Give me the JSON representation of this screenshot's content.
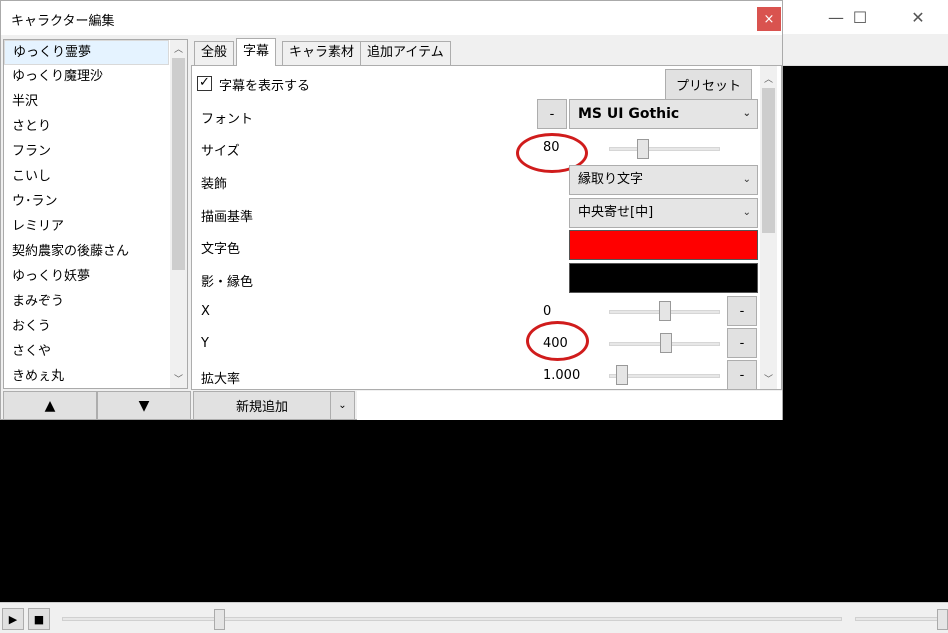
{
  "main_window": {
    "minimize_icon": "—",
    "maximize_icon": "☐",
    "close_icon": "✕"
  },
  "dialog": {
    "title": "キャラクター編集",
    "close_icon": "×"
  },
  "character_list": {
    "selected_index": 0,
    "items": [
      "ゆっくり霊夢",
      "ゆっくり魔理沙",
      "半沢",
      "さとり",
      "フラン",
      "こいし",
      "ウ･ラン",
      "レミリア",
      "契約農家の後藤さん",
      "ゆっくり妖夢",
      "まみぞう",
      "おくう",
      "さくや",
      "きめぇ丸"
    ],
    "up_button": "▲",
    "down_button": "▼"
  },
  "tabs": [
    {
      "label": "全般",
      "active": false
    },
    {
      "label": "字幕",
      "active": true
    },
    {
      "label": "キャラ素材",
      "active": false
    },
    {
      "label": "追加アイテム",
      "active": false
    }
  ],
  "subtitle_panel": {
    "show_subtitle_label": "字幕を表示する",
    "show_subtitle_checked": true,
    "checkmark": "✓",
    "preset_button": "プリセット",
    "font_label": "フォント",
    "font_minus": "-",
    "font_value": "MS UI Gothic",
    "size_label": "サイズ",
    "size_value": "80",
    "decoration_label": "装飾",
    "decoration_value": "縁取り文字",
    "anchor_label": "描画基準",
    "anchor_value": "中央寄せ[中]",
    "text_color_label": "文字色",
    "text_color": "#ff0000",
    "shadow_color_label": "影・縁色",
    "shadow_color": "#000000",
    "x_label": "X",
    "x_value": "0",
    "y_label": "Y",
    "y_value": "400",
    "scale_label": "拡大率",
    "scale_value": "1.000",
    "minus": "-",
    "dropdown_arrow": "⌄"
  },
  "bottom": {
    "add_new_button": "新規追加",
    "add_arrow": "⌄"
  },
  "playbar": {
    "play_icon": "▶",
    "stop_icon": "■"
  },
  "colors": {
    "annotation_red": "#d01c1c",
    "close_button": "#d9534f"
  }
}
